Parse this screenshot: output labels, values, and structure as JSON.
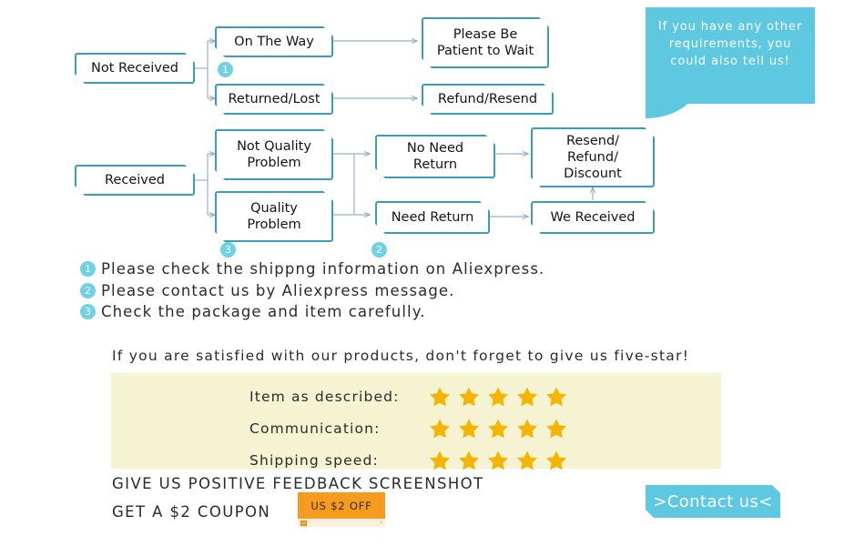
{
  "flowchart": {
    "row1": {
      "root": {
        "label": "Not Received"
      },
      "branches": [
        {
          "label": "On The Way",
          "target": "Please Be\nPatient to Wait"
        },
        {
          "label": "Returned/Lost",
          "target": "Refund/Resend"
        }
      ],
      "badge": "1"
    },
    "row2": {
      "root": {
        "label": "Received"
      },
      "branches": [
        {
          "label": "Not Quality\nProblem"
        },
        {
          "label": "Quality\nProblem"
        }
      ],
      "middle": [
        {
          "label": "No Need\nReturn"
        },
        {
          "label": "Need Return"
        }
      ],
      "ends": [
        {
          "label": "Resend/\nRefund/\nDiscount"
        },
        {
          "label": "We Received"
        }
      ],
      "badge_quality": "3",
      "badge_return": "2"
    }
  },
  "bubble": {
    "text": "If you have any other requirements, you could also tell us!",
    "color": "#5ec8e0"
  },
  "notes": [
    {
      "num": "1",
      "text": "Please check the shippng information on Aliexpress."
    },
    {
      "num": "2",
      "text": "Please contact us by Aliexpress message."
    },
    {
      "num": "3",
      "text": "Check the package and item carefully."
    }
  ],
  "feedback": {
    "headline": "If you are satisfied with our products, don't forget to give us five-star!",
    "box_color": "#f5f3d2",
    "star_color": "#f5b400",
    "ratings": [
      {
        "label": "Item as described:",
        "stars": 5
      },
      {
        "label": "Communication:",
        "stars": 5
      },
      {
        "label": "Shipping speed:",
        "stars": 5
      }
    ]
  },
  "bottom": {
    "line1": "GIVE US POSITIVE FEEDBACK SCREENSHOT",
    "line2": "GET A $2 COUPON",
    "coupon": {
      "label": "US $2 OFF",
      "color": "#f59c20"
    },
    "contact": {
      "label": ">Contact us<",
      "color": "#5ec8e0"
    }
  }
}
